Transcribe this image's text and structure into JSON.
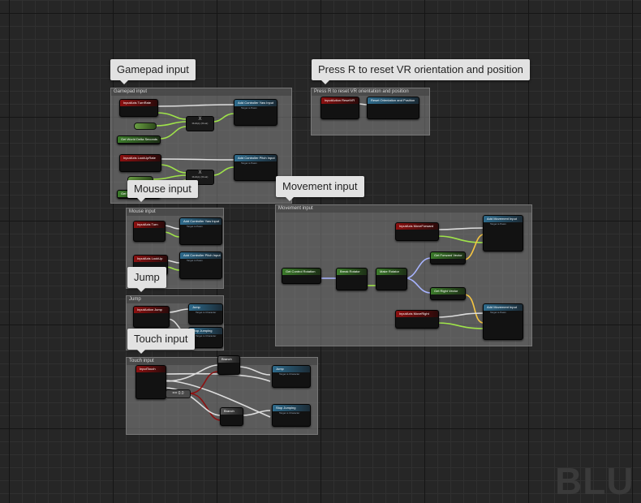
{
  "bubbles": {
    "gamepad": "Gamepad input",
    "reset": "Press R to reset VR orientation and position",
    "mouse": "Mouse input",
    "movement": "Movement input",
    "jump": "Jump",
    "touch": "Touch input"
  },
  "comments": {
    "gamepad": "Gamepad input",
    "reset": "Press R to reset VR orientation and position",
    "mouse": "Mouse input",
    "movement": "Movement input",
    "jump": "Jump",
    "touch": "Touch input"
  },
  "nodes": {
    "turn_rate": "InputAxis TurnRate",
    "add_yaw_1": "Add Controller Yaw Input",
    "target_pawn": "Target is Pawn",
    "get_delta_1": "Get World Delta Seconds",
    "lookup_rate": "InputAxis LookUpRate",
    "add_pitch_1": "Add Controller Pitch Input",
    "get_delta_2": "Get World Delta Seconds",
    "reset_vr_event": "InputAction ResetVR",
    "reset_orientation": "Reset Orientation and Position",
    "turn": "InputAxis Turn",
    "add_yaw_2": "Add Controller Yaw Input",
    "lookup": "InputAxis LookUp",
    "add_pitch_2": "Add Controller Pitch Input",
    "move_forward": "InputAxis MoveForward",
    "add_movement_1": "Add Movement Input",
    "get_control_rotation": "Get Control Rotation",
    "break_rotator": "Break Rotator",
    "make_rotator": "Make Rotator",
    "get_forward_vector": "Get Forward Vector",
    "get_right_vector": "Get Right Vector",
    "move_right": "InputAxis MoveRight",
    "add_movement_2": "Add Movement Input",
    "jump_event": "InputAction Jump",
    "jump_call": "Jump",
    "stop_jumping": "Stop Jumping",
    "target_character": "Target is Character",
    "input_touch": "InputTouch",
    "branch": "Branch",
    "jump_call_2": "Jump",
    "stop_jumping_2": "Stop Jumping",
    "compare": "== 0.0",
    "multiply": "X",
    "multiply_sub": "Multiply (Float)"
  },
  "watermark": "BLU",
  "colors": {
    "exec_wire": "#dddddd",
    "float_wire": "#9fe34a",
    "rotator_wire": "#a8b4ff",
    "vector_wire": "#f5c542",
    "bool_wire": "#8d1212",
    "bubble_bg": "#e2e2e2",
    "event_header": "#8c1010",
    "function_header": "#2e6b8c"
  }
}
